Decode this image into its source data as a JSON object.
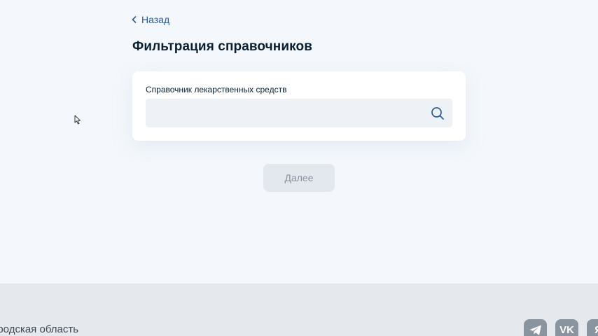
{
  "nav": {
    "back_label": "Назад"
  },
  "page": {
    "title": "Фильтрация справочников"
  },
  "form": {
    "field_label": "Справочник лекарственных средств",
    "search_value": "",
    "search_placeholder": ""
  },
  "actions": {
    "next_label": "Далее",
    "next_disabled": true
  },
  "footer": {
    "region_text": "ородская область",
    "social_vk_label": "VK",
    "social_ok_label": "Я"
  },
  "colors": {
    "link": "#2a5b9a",
    "background": "#f4f8fc",
    "footer": "#e5e9ed",
    "button_disabled": "#e3e8ef"
  },
  "icons": [
    "chevron-left-icon",
    "search-icon",
    "telegram-icon",
    "vk-icon",
    "ok-icon",
    "mouse-cursor-icon"
  ]
}
